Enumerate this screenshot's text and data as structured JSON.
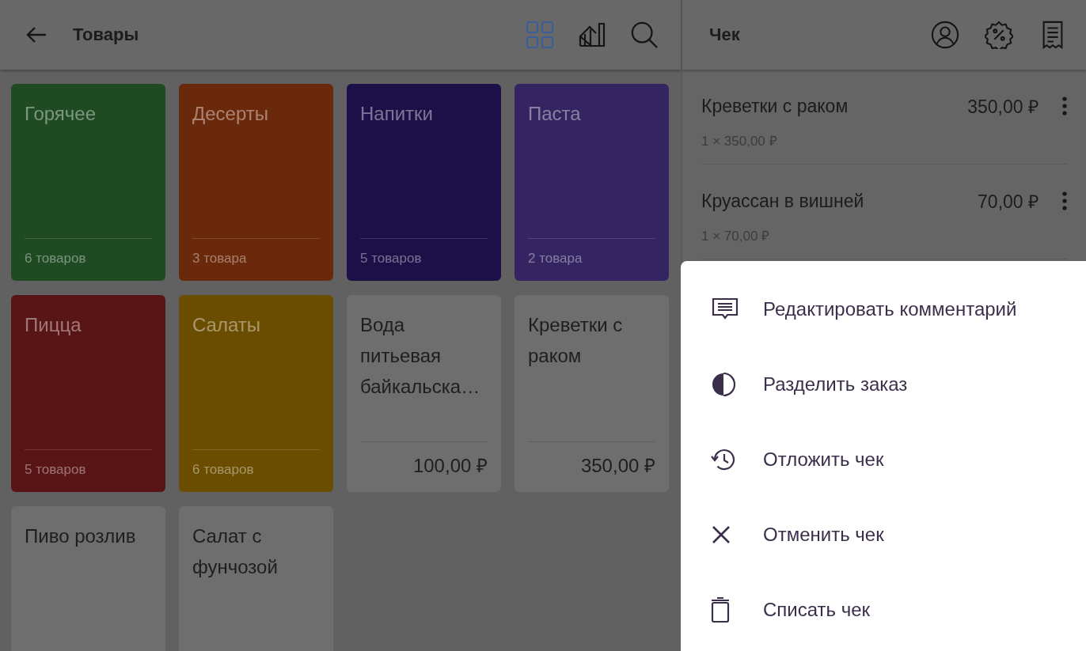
{
  "products_panel": {
    "title": "Товары",
    "grid_view": {
      "selected": true
    },
    "tiles": [
      {
        "kind": "category",
        "name": "Горячее",
        "count": "6 товаров",
        "color": "#1f4a22"
      },
      {
        "kind": "category",
        "name": "Десерты",
        "count": "3 товара",
        "color": "#6b290b"
      },
      {
        "kind": "category",
        "name": "Напитки",
        "count": "5 товаров",
        "color": "#1d1048"
      },
      {
        "kind": "category",
        "name": "Паста",
        "count": "2 товара",
        "color": "#342461"
      },
      {
        "kind": "category",
        "name": "Пицца",
        "count": "5 товаров",
        "color": "#591515"
      },
      {
        "kind": "category",
        "name": "Салаты",
        "count": "6 товаров",
        "color": "#6a4d00"
      },
      {
        "kind": "product",
        "name": "Вода питьевая байкальска…",
        "price": "100,00 ₽"
      },
      {
        "kind": "product",
        "name": "Креветки с раком",
        "price": "350,00 ₽"
      },
      {
        "kind": "product",
        "name": "Пиво розлив"
      },
      {
        "kind": "product",
        "name": "Салат с фунчозой"
      }
    ]
  },
  "receipt": {
    "title": "Чек",
    "items": [
      {
        "name": "Креветки с раком",
        "total": "350,00 ₽",
        "detail": "1 × 350,00 ₽"
      },
      {
        "name": "Круассан в вишней",
        "total": "70,00 ₽",
        "detail": "1 × 70,00 ₽"
      }
    ]
  },
  "menu": [
    {
      "kind": "comment",
      "label": "Редактировать комментарий"
    },
    {
      "kind": "split",
      "label": "Разделить заказ"
    },
    {
      "kind": "postpone",
      "label": "Отложить чек"
    },
    {
      "kind": "cancel",
      "label": "Отменить чек"
    },
    {
      "kind": "writeoff",
      "label": "Списать чек"
    }
  ]
}
